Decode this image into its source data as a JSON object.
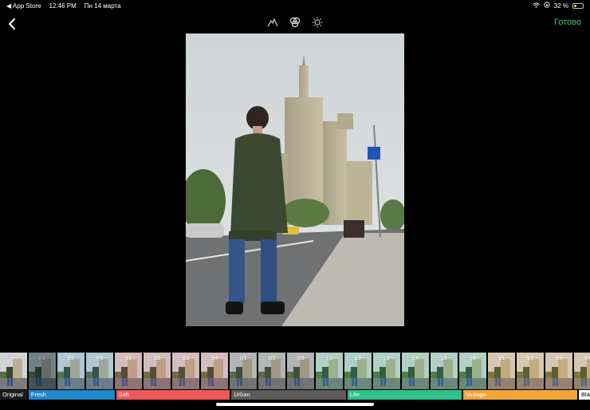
{
  "status_bar": {
    "app_back": "◀ App Store",
    "time": "12:46 PM",
    "date": "Пн 14 марта",
    "battery_text": "32 %",
    "battery_level": 0.32
  },
  "toolbar": {
    "back_icon": "chevron-left-icon",
    "tools": [
      "adjust-icon",
      "filters-icon",
      "brightness-icon"
    ],
    "done_label": "Готово",
    "done_color": "#3ec26e"
  },
  "filters": {
    "thumbnails": [
      "",
      "F1",
      "F2",
      "F3",
      "S1",
      "S2",
      "S3",
      "S4",
      "U1",
      "U2",
      "U3",
      "L1",
      "L2",
      "L3",
      "L4",
      "L5",
      "L6",
      "V1",
      "V2",
      "V3",
      "V4",
      ""
    ],
    "selected": "F1"
  },
  "categories": [
    {
      "label": "Original",
      "color": "#1a1a1a"
    },
    {
      "label": "Fresh",
      "color": "#1f86c8"
    },
    {
      "label": "Soft",
      "color": "#ec5a5a"
    },
    {
      "label": "Urban",
      "color": "#5b5b5b"
    },
    {
      "label": "Life",
      "color": "#2fc18a"
    },
    {
      "label": "Vintage",
      "color": "#f2a53a"
    },
    {
      "label": "Bla",
      "color": "#ffffff"
    }
  ]
}
